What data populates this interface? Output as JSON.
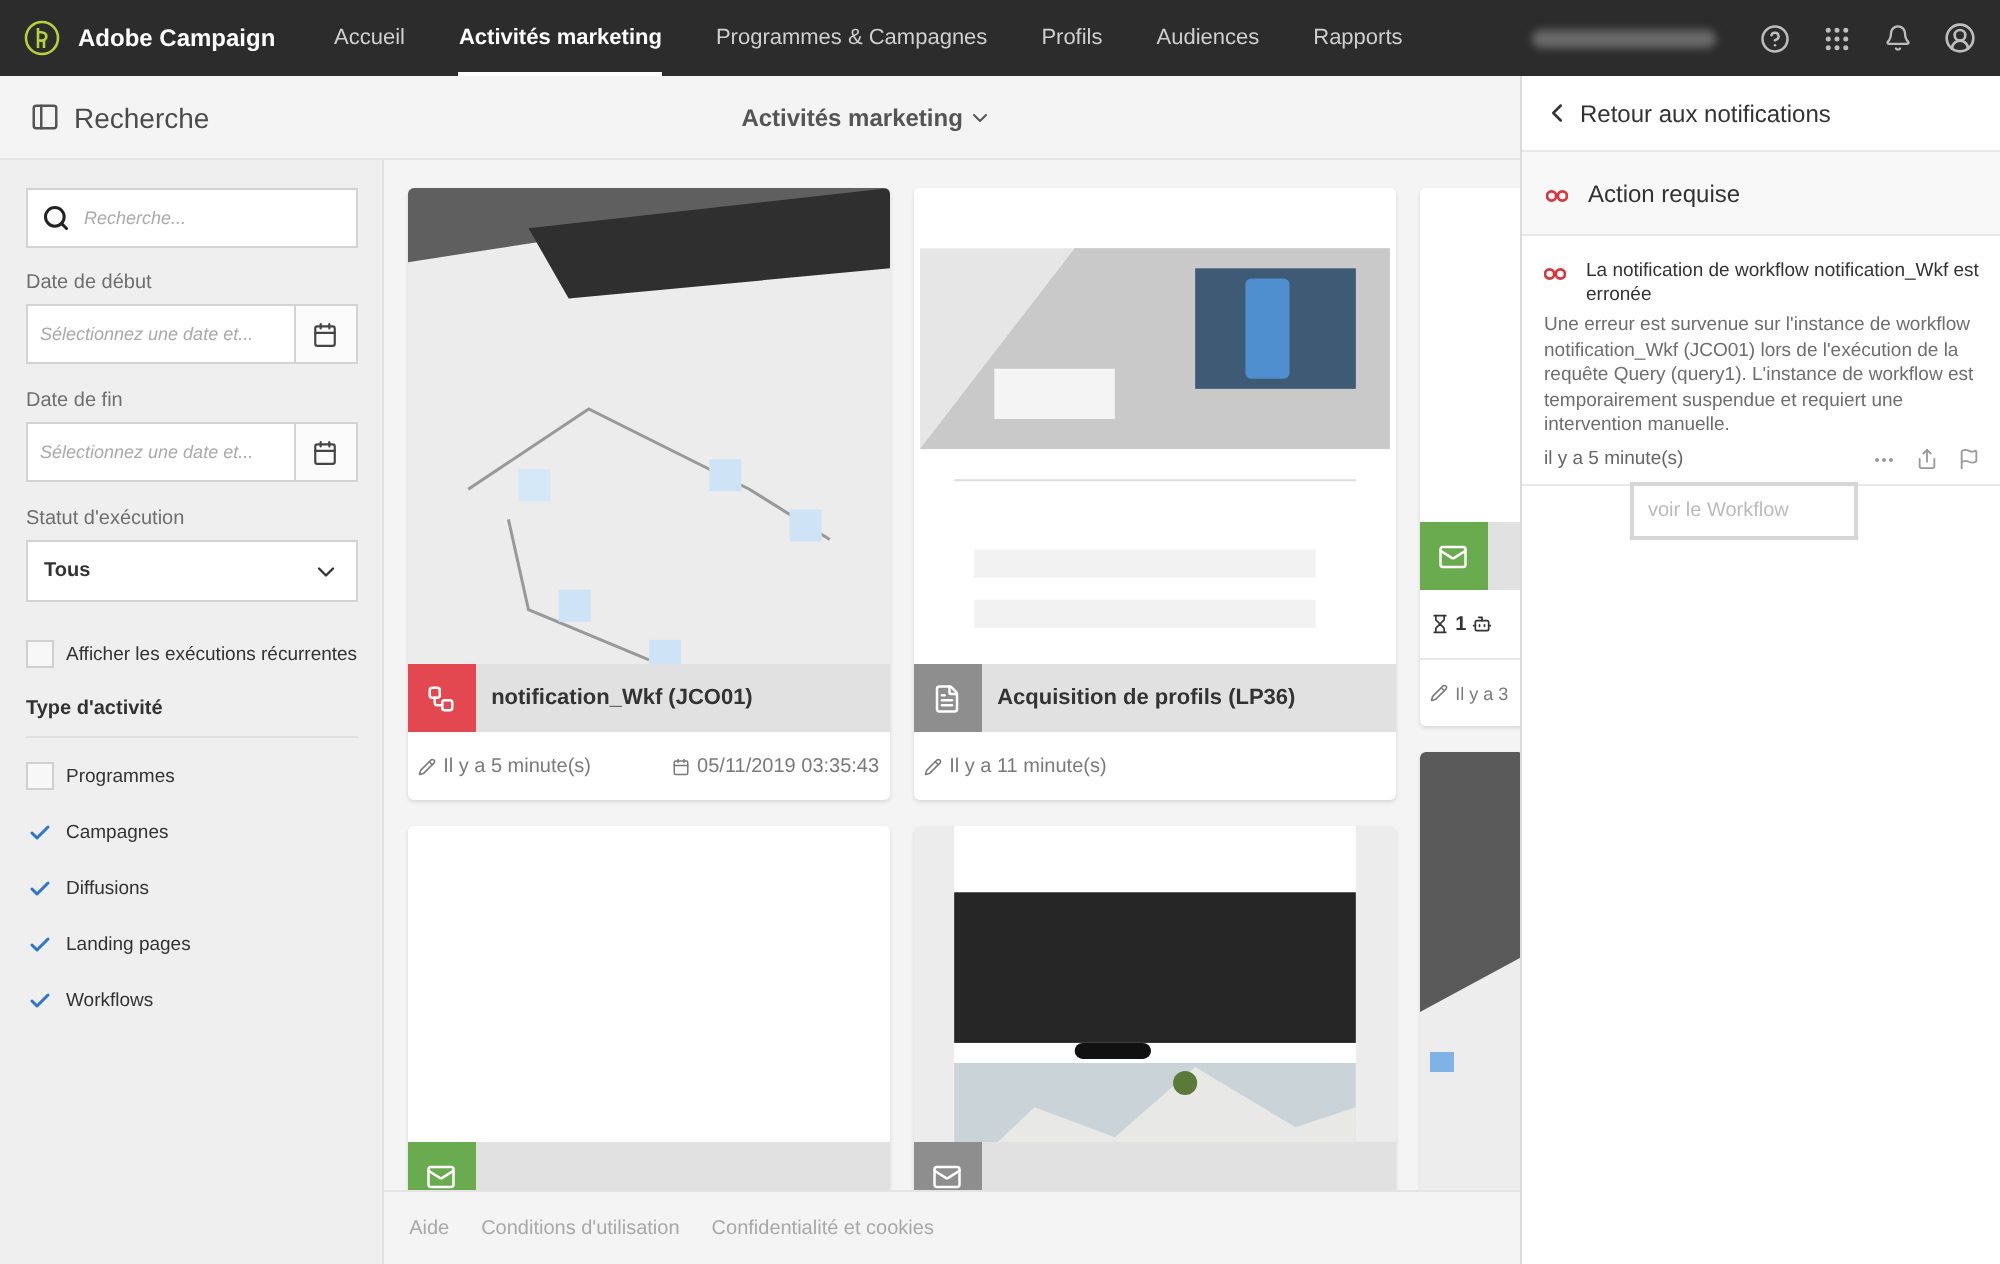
{
  "app": {
    "name": "Adobe Campaign"
  },
  "nav": [
    {
      "label": "Accueil",
      "selected": false
    },
    {
      "label": "Activités marketing",
      "selected": true
    },
    {
      "label": "Programmes & Campagnes",
      "selected": false
    },
    {
      "label": "Profils",
      "selected": false
    },
    {
      "label": "Audiences",
      "selected": false
    },
    {
      "label": "Rapports",
      "selected": false
    }
  ],
  "toolbar": {
    "panel_title": "Recherche",
    "view_title": "Activités marketing"
  },
  "filters": {
    "search_placeholder": "Recherche...",
    "start_date": {
      "label": "Date de début",
      "placeholder": "Sélectionnez une date et..."
    },
    "end_date": {
      "label": "Date de fin",
      "placeholder": "Sélectionnez une date et..."
    },
    "status": {
      "label": "Statut d'exécution",
      "value": "Tous"
    },
    "recurring": {
      "label": "Afficher les exécutions récurrentes",
      "checked": false
    },
    "activity_type": {
      "title": "Type d'activité",
      "options": [
        {
          "label": "Programmes",
          "checked": false
        },
        {
          "label": "Campagnes",
          "checked": true
        },
        {
          "label": "Diffusions",
          "checked": true
        },
        {
          "label": "Landing pages",
          "checked": true
        },
        {
          "label": "Workflows",
          "checked": true
        }
      ]
    }
  },
  "card_columns": [
    [
      {
        "kind": "workflow",
        "color": "#e34850",
        "title": "notification_Wkf (JCO01)",
        "modified": "Il y a 5 minute(s)",
        "date": "05/11/2019 03:35:43"
      },
      {
        "kind": "email",
        "color": "#6aab4f"
      }
    ],
    [
      {
        "kind": "landing",
        "color": "#8e8e8e",
        "title": "Acquisition de profils (LP36)",
        "modified": "Il y a 11 minute(s)"
      },
      {
        "kind": "email",
        "color": "#8e8e8e"
      }
    ],
    [
      {
        "kind": "email",
        "color": "#6aab4f",
        "count": "1",
        "modified": "Il y a 3"
      },
      {
        "kind": "plain"
      }
    ]
  ],
  "footer": [
    "Aide",
    "Conditions d'utilisation",
    "Confidentialité et cookies"
  ],
  "notifications": {
    "back": "Retour aux notifications",
    "section": "Action requise",
    "items": [
      {
        "title": "La notification de workflow notification_Wkf est erronée",
        "body": "Une erreur est survenue sur l'instance de workflow notification_Wkf (JCO01) lors de l'exécution de la requête Query (query1). L'instance de workflow est temporairement suspendue et requiert une intervention manuelle.",
        "time": "il y a 5 minute(s)"
      }
    ],
    "action": "voir le Workflow"
  }
}
